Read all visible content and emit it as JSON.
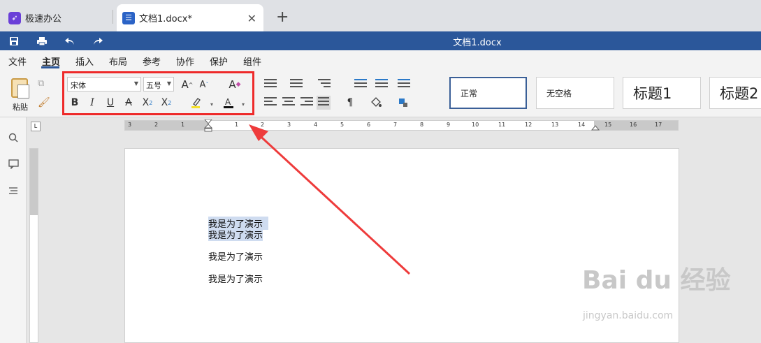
{
  "tabs": {
    "home": {
      "label": "极速办公",
      "icon": "rocket-icon"
    },
    "doc": {
      "label": "文档1.docx*",
      "icon": "document-icon",
      "close": "✕"
    },
    "add": "+"
  },
  "titlebar": {
    "title": "文档1.docx",
    "accent": "#2b579a"
  },
  "menu": {
    "items": [
      "文件",
      "主页",
      "插入",
      "布局",
      "参考",
      "协作",
      "保护",
      "组件"
    ],
    "active": "主页"
  },
  "ribbon": {
    "paste_label": "粘贴",
    "font_name": "宋体",
    "font_size": "五号",
    "styles": [
      "正常",
      "无空格",
      "标题1",
      "标题2"
    ]
  },
  "ruler": {
    "numbers": [
      "3",
      "2",
      "1",
      "1",
      "2",
      "3",
      "4",
      "5",
      "6",
      "7",
      "8",
      "9",
      "10",
      "11",
      "12",
      "13",
      "14",
      "15",
      "16",
      "17"
    ],
    "corner": "L"
  },
  "document": {
    "lines": [
      "我是为了演示",
      "我是为了演示",
      "我是为了演示",
      "我是为了演示"
    ]
  },
  "watermark": {
    "brand": "Bai du 经验",
    "url": "jingyan.baidu.com"
  },
  "colors": {
    "highlight": "#ee2a2a",
    "selection": "#cfdcf0"
  }
}
